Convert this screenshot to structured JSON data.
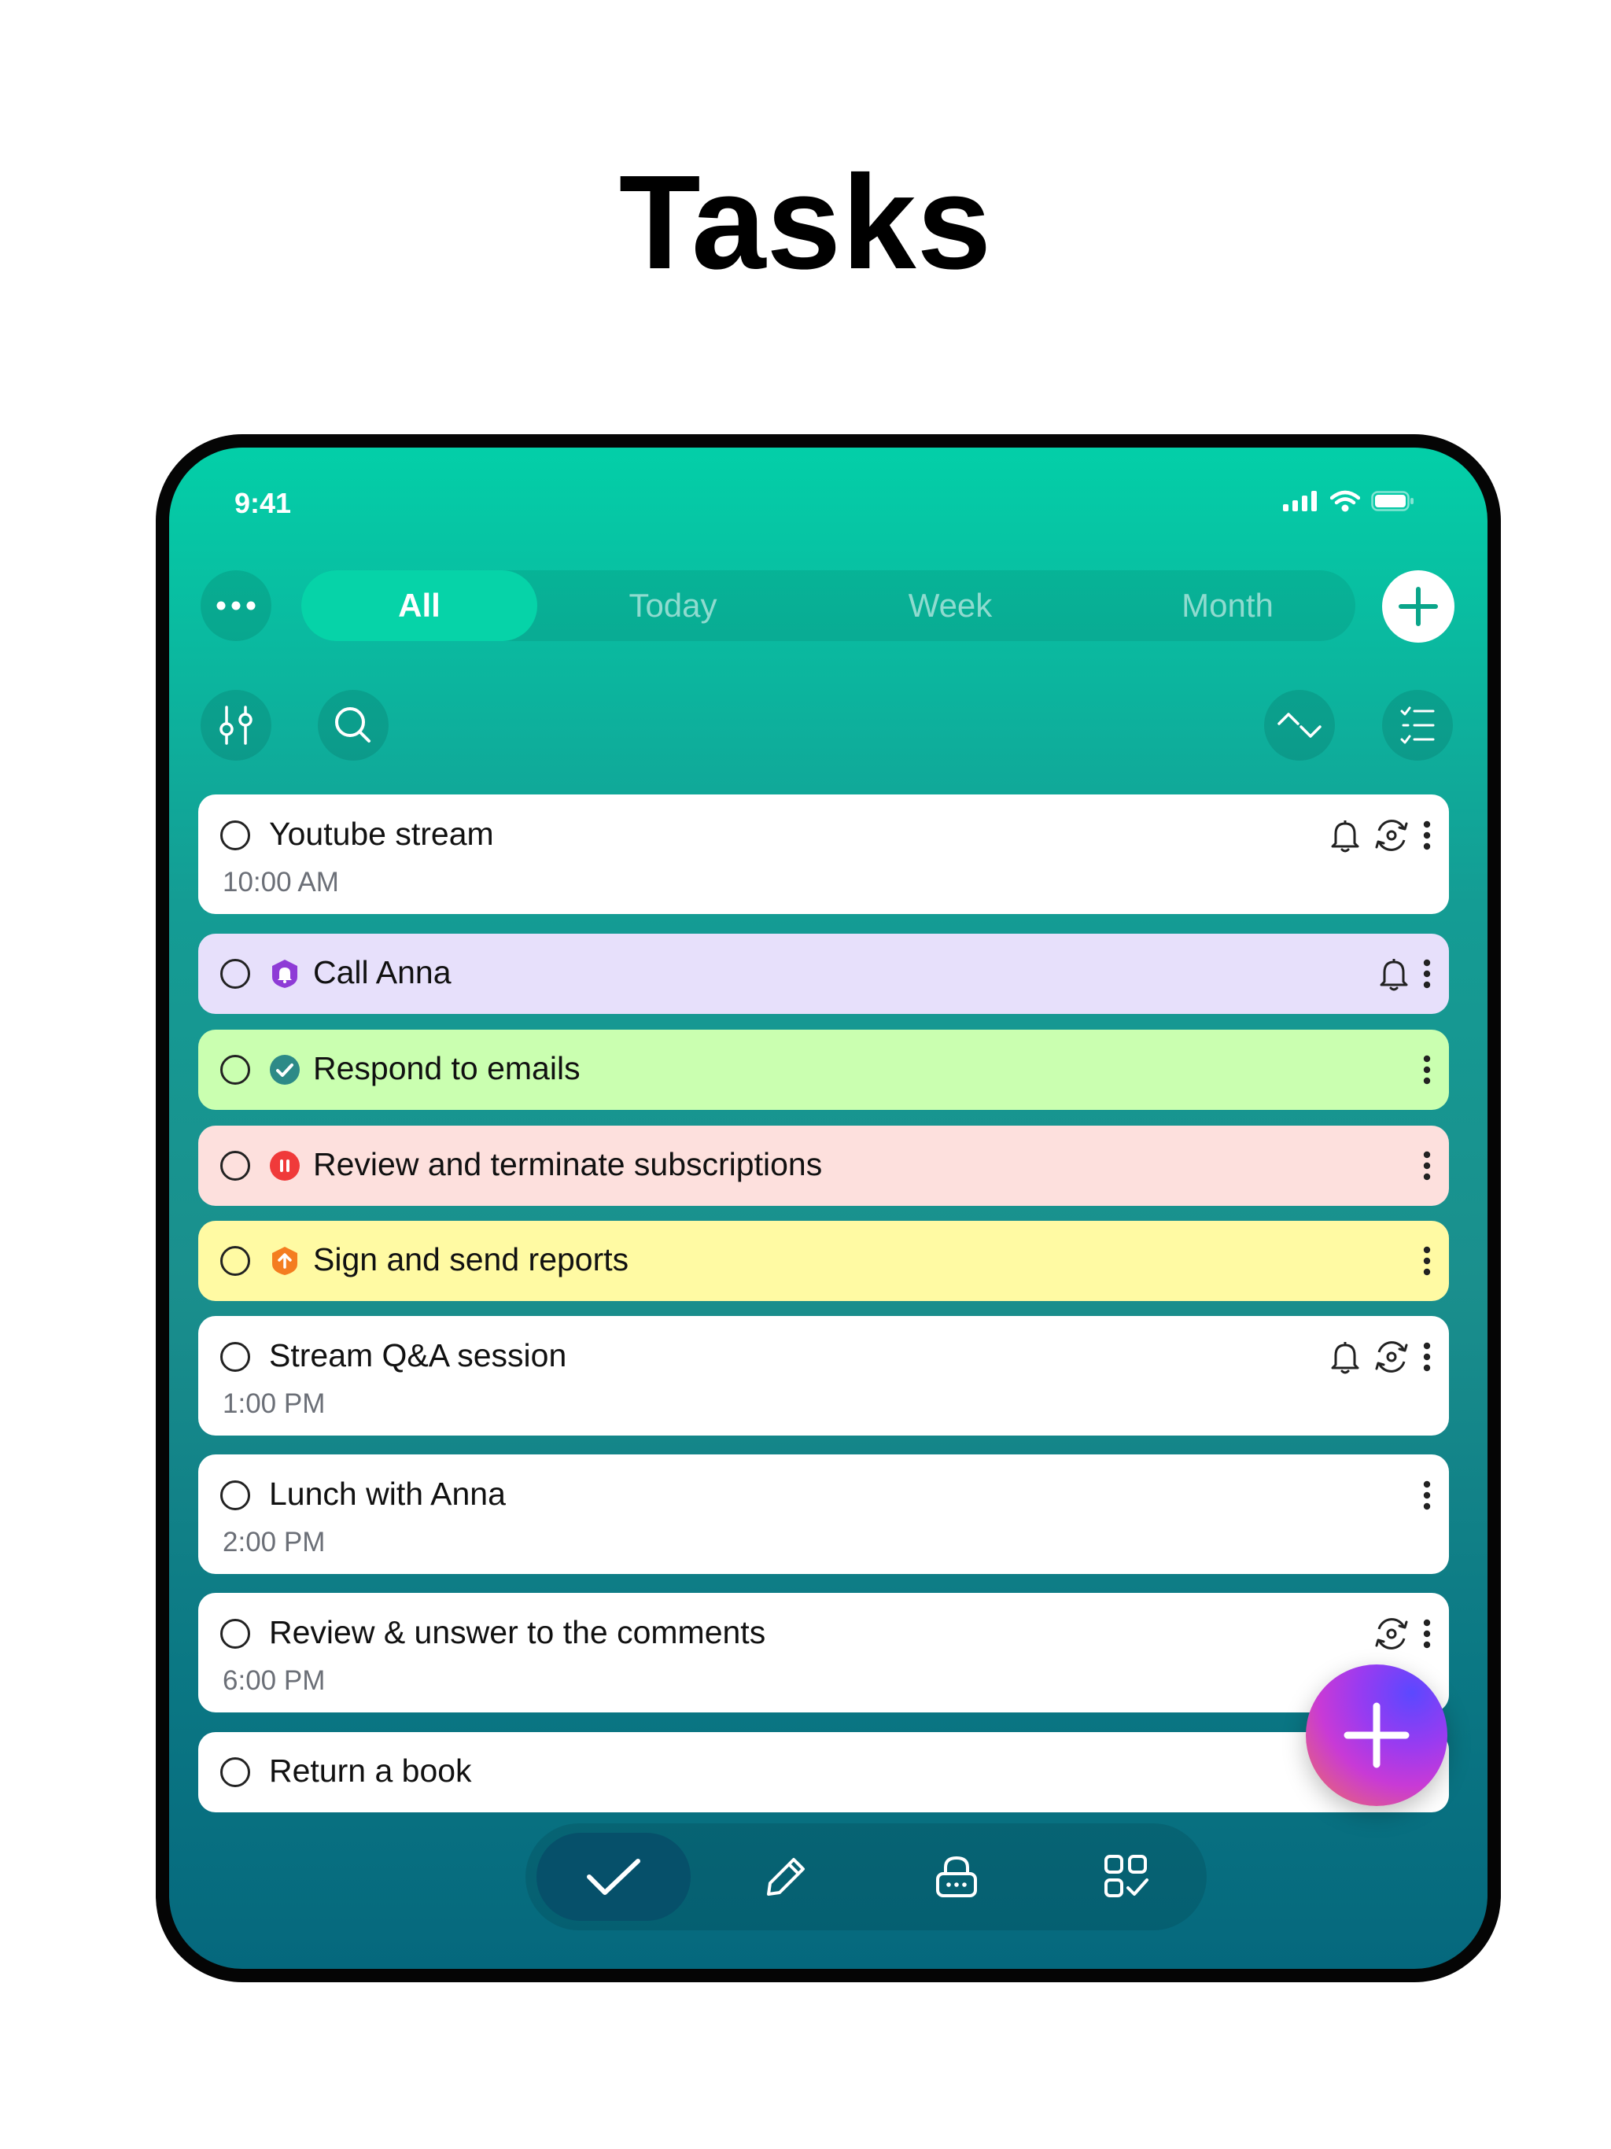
{
  "headline": "Tasks",
  "status": {
    "time": "9:41"
  },
  "segments": [
    {
      "label": "All",
      "active": true
    },
    {
      "label": "Today",
      "active": false
    },
    {
      "label": "Week",
      "active": false
    },
    {
      "label": "Month",
      "active": false
    }
  ],
  "tasks": [
    {
      "title": "Youtube stream",
      "time": "10:00 AM",
      "color": "#ffffff",
      "badge": "",
      "icons": [
        "bell-icon",
        "repeat-icon",
        "more-icon"
      ]
    },
    {
      "title": "Call Anna",
      "time": "",
      "color": "#e7e0fb",
      "badge": "shield-purple",
      "icons": [
        "bell-icon",
        "more-icon"
      ]
    },
    {
      "title": "Respond to emails",
      "time": "",
      "color": "#caffb0",
      "badge": "check-teal",
      "icons": [
        "more-icon"
      ]
    },
    {
      "title": "Review and terminate subscriptions",
      "time": "",
      "color": "#fde0dd",
      "badge": "pause-red",
      "icons": [
        "more-icon"
      ]
    },
    {
      "title": "Sign and send reports",
      "time": "",
      "color": "#fffaa3",
      "badge": "up-orange",
      "icons": [
        "more-icon"
      ]
    },
    {
      "title": "Stream Q&A session",
      "time": "1:00 PM",
      "color": "#ffffff",
      "badge": "",
      "icons": [
        "bell-icon",
        "repeat-icon",
        "more-icon"
      ]
    },
    {
      "title": "Lunch with Anna",
      "time": "2:00 PM",
      "color": "#ffffff",
      "badge": "",
      "icons": [
        "more-icon"
      ]
    },
    {
      "title": "Review & unswer to the comments",
      "time": "6:00 PM",
      "color": "#ffffff",
      "badge": "",
      "icons": [
        "repeat-icon",
        "more-icon"
      ]
    },
    {
      "title": "Return a book",
      "time": "",
      "color": "#ffffff",
      "badge": "",
      "icons": []
    }
  ],
  "tabbar": [
    "tasks-check-icon",
    "pencil-icon",
    "password-icon",
    "grid-check-icon"
  ],
  "colors": {
    "accent": "#06d3a8",
    "tabbar_active": "#06506a"
  }
}
